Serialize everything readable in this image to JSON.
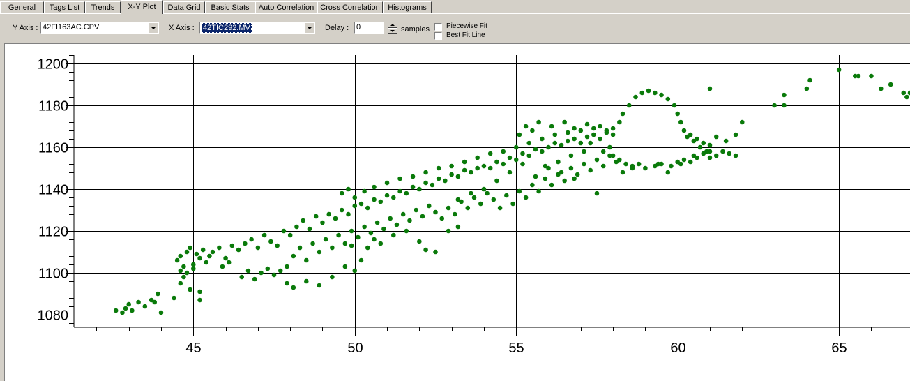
{
  "tabs": [
    "General",
    "Tags List",
    "Trends",
    "X-Y Plot",
    "Data Grid",
    "Basic Stats",
    "Auto Correlation",
    "Cross Correlation",
    "Histograms"
  ],
  "active_tab": "X-Y Plot",
  "toolbar": {
    "y_axis_label": "Y Axis :",
    "y_axis_value": "42FI163AC.CPV",
    "x_axis_label": "X Axis :",
    "x_axis_value": "42TIC292.MV",
    "delay_label": "Delay :",
    "delay_value": "0",
    "samples_label": "samples",
    "piecewise_fit_label": "Piecewise Fit",
    "best_fit_label": "Best Fit Line"
  },
  "colors": {
    "points": "#0a7a0a",
    "grid": "#000000"
  },
  "chart_data": {
    "type": "scatter",
    "title": "",
    "xlabel": "",
    "ylabel": "",
    "xlim": [
      41.3,
      67.2
    ],
    "ylim": [
      1074,
      1204
    ],
    "x_ticks": [
      45,
      50,
      55,
      60,
      65
    ],
    "y_ticks": [
      1080,
      1100,
      1120,
      1140,
      1160,
      1180,
      1200
    ],
    "grid": true,
    "series": [
      {
        "points": [
          [
            42.6,
            1082
          ],
          [
            42.8,
            1081
          ],
          [
            42.9,
            1083
          ],
          [
            43.1,
            1082
          ],
          [
            43.0,
            1085
          ],
          [
            43.3,
            1086
          ],
          [
            43.5,
            1084
          ],
          [
            43.7,
            1087
          ],
          [
            43.9,
            1090
          ],
          [
            44.0,
            1081
          ],
          [
            43.8,
            1086
          ],
          [
            44.4,
            1088
          ],
          [
            44.6,
            1095
          ],
          [
            44.9,
            1092
          ],
          [
            45.2,
            1091
          ],
          [
            45.2,
            1087
          ],
          [
            44.7,
            1098
          ],
          [
            44.5,
            1106
          ],
          [
            44.6,
            1108
          ],
          [
            44.7,
            1103
          ],
          [
            44.8,
            1110
          ],
          [
            44.9,
            1112
          ],
          [
            45.0,
            1104
          ],
          [
            45.1,
            1109
          ],
          [
            45.2,
            1107
          ],
          [
            45.3,
            1111
          ],
          [
            45.4,
            1105
          ],
          [
            45.5,
            1108
          ],
          [
            44.6,
            1101
          ],
          [
            44.8,
            1100
          ],
          [
            45.0,
            1102
          ],
          [
            45.6,
            1110
          ],
          [
            45.8,
            1112
          ],
          [
            46.0,
            1107
          ],
          [
            46.2,
            1113
          ],
          [
            46.4,
            1111
          ],
          [
            46.6,
            1114
          ],
          [
            46.8,
            1116
          ],
          [
            47.0,
            1112
          ],
          [
            47.2,
            1118
          ],
          [
            47.4,
            1115
          ],
          [
            46.5,
            1098
          ],
          [
            46.7,
            1101
          ],
          [
            46.9,
            1097
          ],
          [
            47.1,
            1100
          ],
          [
            47.3,
            1102
          ],
          [
            47.5,
            1099
          ],
          [
            47.7,
            1101
          ],
          [
            47.9,
            1103
          ],
          [
            46.1,
            1105
          ],
          [
            45.9,
            1103
          ],
          [
            47.6,
            1113
          ],
          [
            47.8,
            1120
          ],
          [
            48.0,
            1118
          ],
          [
            48.2,
            1122
          ],
          [
            48.4,
            1125
          ],
          [
            48.6,
            1121
          ],
          [
            48.8,
            1127
          ],
          [
            49.0,
            1124
          ],
          [
            49.2,
            1128
          ],
          [
            49.4,
            1126
          ],
          [
            49.6,
            1130
          ],
          [
            49.8,
            1128
          ],
          [
            50.0,
            1132
          ],
          [
            50.2,
            1133
          ],
          [
            50.4,
            1131
          ],
          [
            50.6,
            1135
          ],
          [
            50.8,
            1134
          ],
          [
            51.0,
            1137
          ],
          [
            51.2,
            1136
          ],
          [
            51.4,
            1139
          ],
          [
            51.6,
            1138
          ],
          [
            51.8,
            1141
          ],
          [
            52.0,
            1140
          ],
          [
            52.2,
            1143
          ],
          [
            52.4,
            1142
          ],
          [
            52.6,
            1145
          ],
          [
            52.8,
            1144
          ],
          [
            53.0,
            1147
          ],
          [
            53.2,
            1146
          ],
          [
            53.4,
            1149
          ],
          [
            53.6,
            1148
          ],
          [
            53.8,
            1150
          ],
          [
            54.0,
            1151
          ],
          [
            54.2,
            1150
          ],
          [
            54.4,
            1153
          ],
          [
            54.6,
            1152
          ],
          [
            54.8,
            1155
          ],
          [
            55.0,
            1154
          ],
          [
            55.2,
            1157
          ],
          [
            55.4,
            1156
          ],
          [
            55.6,
            1159
          ],
          [
            55.8,
            1158
          ],
          [
            56.0,
            1160
          ],
          [
            56.2,
            1162
          ],
          [
            56.4,
            1161
          ],
          [
            56.6,
            1163
          ],
          [
            56.8,
            1164
          ],
          [
            57.0,
            1162
          ],
          [
            57.2,
            1165
          ],
          [
            57.4,
            1166
          ],
          [
            57.6,
            1164
          ],
          [
            57.8,
            1167
          ],
          [
            58.0,
            1166
          ],
          [
            48.1,
            1108
          ],
          [
            48.3,
            1112
          ],
          [
            48.5,
            1106
          ],
          [
            48.7,
            1114
          ],
          [
            48.9,
            1110
          ],
          [
            49.1,
            1116
          ],
          [
            49.3,
            1112
          ],
          [
            49.5,
            1118
          ],
          [
            49.7,
            1114
          ],
          [
            49.9,
            1120
          ],
          [
            50.1,
            1117
          ],
          [
            50.3,
            1122
          ],
          [
            50.5,
            1119
          ],
          [
            50.7,
            1124
          ],
          [
            50.9,
            1121
          ],
          [
            51.1,
            1126
          ],
          [
            51.3,
            1123
          ],
          [
            51.5,
            1128
          ],
          [
            51.7,
            1125
          ],
          [
            51.9,
            1130
          ],
          [
            52.1,
            1127
          ],
          [
            52.3,
            1132
          ],
          [
            52.5,
            1129
          ],
          [
            52.7,
            1126
          ],
          [
            52.9,
            1131
          ],
          [
            53.1,
            1128
          ],
          [
            53.3,
            1134
          ],
          [
            53.5,
            1131
          ],
          [
            53.7,
            1136
          ],
          [
            53.9,
            1133
          ],
          [
            54.1,
            1138
          ],
          [
            54.3,
            1135
          ],
          [
            54.5,
            1131
          ],
          [
            54.7,
            1137
          ],
          [
            54.9,
            1133
          ],
          [
            55.1,
            1139
          ],
          [
            55.3,
            1136
          ],
          [
            55.5,
            1142
          ],
          [
            55.7,
            1139
          ],
          [
            55.9,
            1145
          ],
          [
            56.1,
            1142
          ],
          [
            56.3,
            1147
          ],
          [
            56.5,
            1144
          ],
          [
            56.7,
            1150
          ],
          [
            56.9,
            1147
          ],
          [
            57.1,
            1152
          ],
          [
            57.3,
            1149
          ],
          [
            57.5,
            1154
          ],
          [
            57.7,
            1151
          ],
          [
            57.9,
            1156
          ],
          [
            58.1,
            1153
          ],
          [
            47.9,
            1095
          ],
          [
            48.1,
            1093
          ],
          [
            48.5,
            1096
          ],
          [
            48.9,
            1094
          ],
          [
            49.3,
            1098
          ],
          [
            49.7,
            1103
          ],
          [
            50.0,
            1101
          ],
          [
            49.9,
            1113
          ],
          [
            50.2,
            1106
          ],
          [
            50.4,
            1112
          ],
          [
            50.6,
            1116
          ],
          [
            50.8,
            1114
          ],
          [
            51.2,
            1118
          ],
          [
            51.6,
            1120
          ],
          [
            52.0,
            1115
          ],
          [
            52.2,
            1111
          ],
          [
            52.5,
            1110
          ],
          [
            52.9,
            1120
          ],
          [
            53.2,
            1122
          ],
          [
            49.6,
            1138
          ],
          [
            49.8,
            1140
          ],
          [
            50.0,
            1136
          ],
          [
            50.3,
            1139
          ],
          [
            50.6,
            1141
          ],
          [
            51.0,
            1143
          ],
          [
            51.4,
            1145
          ],
          [
            51.8,
            1146
          ],
          [
            52.2,
            1148
          ],
          [
            52.6,
            1150
          ],
          [
            53.0,
            1151
          ],
          [
            53.4,
            1153
          ],
          [
            53.8,
            1155
          ],
          [
            54.2,
            1157
          ],
          [
            54.6,
            1158
          ],
          [
            55.0,
            1160
          ],
          [
            55.4,
            1162
          ],
          [
            55.8,
            1164
          ],
          [
            56.2,
            1166
          ],
          [
            56.6,
            1167
          ],
          [
            57.0,
            1168
          ],
          [
            57.4,
            1169
          ],
          [
            57.8,
            1168
          ],
          [
            55.1,
            1166
          ],
          [
            55.3,
            1170
          ],
          [
            55.5,
            1168
          ],
          [
            55.7,
            1172
          ],
          [
            56.1,
            1170
          ],
          [
            56.5,
            1172
          ],
          [
            56.8,
            1169
          ],
          [
            57.2,
            1171
          ],
          [
            57.6,
            1170
          ],
          [
            58.0,
            1169
          ],
          [
            57.9,
            1160
          ],
          [
            58.0,
            1156
          ],
          [
            57.7,
            1158
          ],
          [
            58.2,
            1154
          ],
          [
            58.4,
            1152
          ],
          [
            58.6,
            1151
          ],
          [
            58.8,
            1152
          ],
          [
            59.0,
            1150
          ],
          [
            59.3,
            1151
          ],
          [
            59.5,
            1152
          ],
          [
            59.8,
            1151
          ],
          [
            60.0,
            1153
          ],
          [
            60.2,
            1154
          ],
          [
            60.4,
            1153
          ],
          [
            60.6,
            1155
          ],
          [
            60.8,
            1157
          ],
          [
            61.0,
            1158
          ],
          [
            61.2,
            1156
          ],
          [
            61.4,
            1158
          ],
          [
            61.6,
            1157
          ],
          [
            61.8,
            1156
          ],
          [
            61.0,
            1155
          ],
          [
            60.5,
            1156
          ],
          [
            60.1,
            1152
          ],
          [
            59.7,
            1148
          ],
          [
            59.4,
            1152
          ],
          [
            58.2,
            1172
          ],
          [
            58.3,
            1176
          ],
          [
            58.5,
            1180
          ],
          [
            58.7,
            1184
          ],
          [
            58.9,
            1186
          ],
          [
            59.1,
            1187
          ],
          [
            59.3,
            1186
          ],
          [
            59.5,
            1185
          ],
          [
            59.7,
            1183
          ],
          [
            59.9,
            1180
          ],
          [
            60.0,
            1176
          ],
          [
            60.1,
            1172
          ],
          [
            60.2,
            1168
          ],
          [
            60.4,
            1166
          ],
          [
            60.6,
            1164
          ],
          [
            60.8,
            1162
          ],
          [
            61.0,
            1161
          ],
          [
            60.9,
            1158
          ],
          [
            60.7,
            1160
          ],
          [
            60.5,
            1163
          ],
          [
            60.3,
            1165
          ],
          [
            61.2,
            1165
          ],
          [
            61.5,
            1163
          ],
          [
            61.8,
            1166
          ],
          [
            62.0,
            1172
          ],
          [
            61.0,
            1188
          ],
          [
            63.0,
            1180
          ],
          [
            63.3,
            1180
          ],
          [
            63.3,
            1185
          ],
          [
            64.0,
            1188
          ],
          [
            64.1,
            1192
          ],
          [
            65.0,
            1197
          ],
          [
            65.5,
            1194
          ],
          [
            65.6,
            1194
          ],
          [
            66.0,
            1194
          ],
          [
            66.3,
            1188
          ],
          [
            66.6,
            1190
          ],
          [
            67.0,
            1186
          ],
          [
            67.1,
            1184
          ],
          [
            67.2,
            1186
          ],
          [
            57.5,
            1138
          ],
          [
            56.8,
            1145
          ],
          [
            56.4,
            1148
          ],
          [
            56.0,
            1150
          ],
          [
            55.6,
            1146
          ],
          [
            55.2,
            1152
          ],
          [
            54.8,
            1148
          ],
          [
            54.4,
            1144
          ],
          [
            54.0,
            1140
          ],
          [
            53.6,
            1138
          ],
          [
            53.2,
            1135
          ],
          [
            58.3,
            1148
          ],
          [
            58.6,
            1150
          ],
          [
            57.3,
            1162
          ],
          [
            57.1,
            1158
          ],
          [
            56.7,
            1156
          ],
          [
            56.3,
            1153
          ],
          [
            55.9,
            1151
          ]
        ]
      }
    ]
  }
}
